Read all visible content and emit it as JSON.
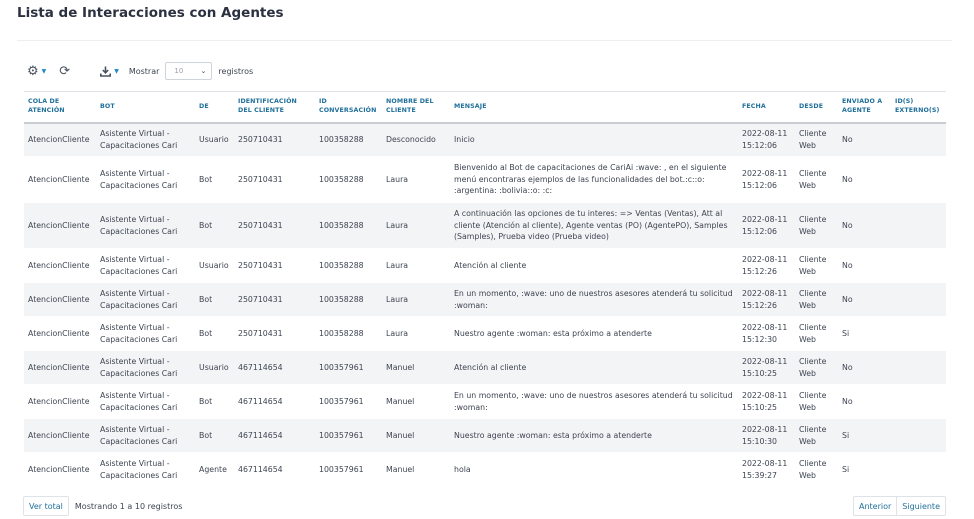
{
  "page": {
    "title": "Lista de Interacciones con Agentes"
  },
  "toolbar": {
    "gear_icon": "gear-icon",
    "refresh_icon": "refresh-icon",
    "download_icon": "download-icon",
    "show_label": "Mostrar",
    "page_size": "10",
    "records_label": "registros"
  },
  "table": {
    "headers": [
      "COLA DE ATENCIÓN",
      "BOT",
      "DE",
      "IDENTIFICACIÓN DEL CLIENTE",
      "ID CONVERSACIÓN",
      "NOMBRE DEL CLIENTE",
      "MENSAJE",
      "FECHA",
      "DESDE",
      "ENVIADO A AGENTE",
      "ID(S) EXTERNO(S)"
    ],
    "rows": [
      [
        "AtencionCliente",
        "Asistente Virtual - Capacitaciones Cari",
        "Usuario",
        "250710431",
        "100358288",
        "Desconocido",
        "Inicio",
        "2022-08-11 15:12:06",
        "Cliente Web",
        "No",
        ""
      ],
      [
        "AtencionCliente",
        "Asistente Virtual - Capacitaciones Cari",
        "Bot",
        "250710431",
        "100358288",
        "Laura",
        "Bienvenido al Bot de capacitaciones de CariAi :wave: , en el siguiente menú encontraras ejemplos de las funcionalidades del bot.:c::o: :argentina: :bolivia::o: :c:",
        "2022-08-11 15:12:06",
        "Cliente Web",
        "No",
        ""
      ],
      [
        "AtencionCliente",
        "Asistente Virtual - Capacitaciones Cari",
        "Bot",
        "250710431",
        "100358288",
        "Laura",
        "A continuación las opciones de tu interes: => Ventas (Ventas), Att al cliente (Atención al cliente), Agente ventas (PO) (AgentePO), Samples (Samples), Prueba video (Prueba video)",
        "2022-08-11 15:12:06",
        "Cliente Web",
        "No",
        ""
      ],
      [
        "AtencionCliente",
        "Asistente Virtual - Capacitaciones Cari",
        "Usuario",
        "250710431",
        "100358288",
        "Laura",
        "Atención al cliente",
        "2022-08-11 15:12:26",
        "Cliente Web",
        "No",
        ""
      ],
      [
        "AtencionCliente",
        "Asistente Virtual - Capacitaciones Cari",
        "Bot",
        "250710431",
        "100358288",
        "Laura",
        "En un momento, :wave: uno de nuestros asesores atenderá tu solicitud :woman:",
        "2022-08-11 15:12:26",
        "Cliente Web",
        "No",
        ""
      ],
      [
        "AtencionCliente",
        "Asistente Virtual - Capacitaciones Cari",
        "Bot",
        "250710431",
        "100358288",
        "Laura",
        "Nuestro agente :woman: esta próximo a atenderte",
        "2022-08-11 15:12:30",
        "Cliente Web",
        "Si",
        ""
      ],
      [
        "AtencionCliente",
        "Asistente Virtual - Capacitaciones Cari",
        "Usuario",
        "467114654",
        "100357961",
        "Manuel",
        "Atención al cliente",
        "2022-08-11 15:10:25",
        "Cliente Web",
        "No",
        ""
      ],
      [
        "AtencionCliente",
        "Asistente Virtual - Capacitaciones Cari",
        "Bot",
        "467114654",
        "100357961",
        "Manuel",
        "En un momento, :wave: uno de nuestros asesores atenderá tu solicitud :woman:",
        "2022-08-11 15:10:25",
        "Cliente Web",
        "No",
        ""
      ],
      [
        "AtencionCliente",
        "Asistente Virtual - Capacitaciones Cari",
        "Bot",
        "467114654",
        "100357961",
        "Manuel",
        "Nuestro agente :woman: esta próximo a atenderte",
        "2022-08-11 15:10:30",
        "Cliente Web",
        "Si",
        ""
      ],
      [
        "AtencionCliente",
        "Asistente Virtual - Capacitaciones Cari",
        "Agente",
        "467114654",
        "100357961",
        "Manuel",
        "hola",
        "2022-08-11 15:39:27",
        "Cliente Web",
        "Si",
        ""
      ]
    ]
  },
  "footer": {
    "view_all_label": "Ver total",
    "showing_text": "Mostrando 1 a 10 registros",
    "prev_label": "Anterior",
    "next_label": "Siguiente"
  },
  "colors": {
    "accent": "#1f6f9a",
    "stripe": "#f3f4f6",
    "caret": "#1e88c8"
  }
}
